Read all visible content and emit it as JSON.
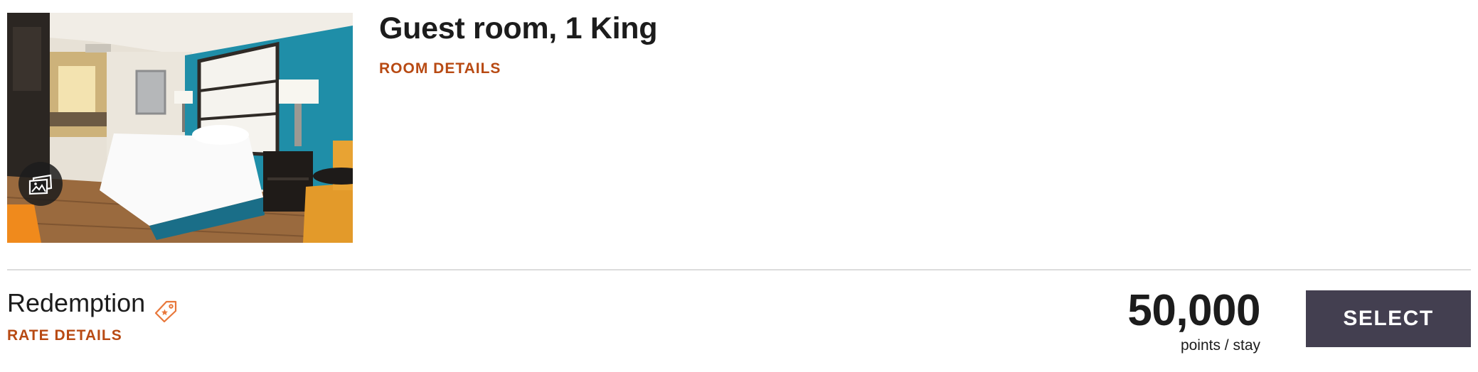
{
  "room": {
    "title": "Guest room, 1 King",
    "details_link": "ROOM DETAILS",
    "photo_icon": "photo-gallery-icon"
  },
  "rate": {
    "name": "Redemption",
    "tag_icon": "tag-icon",
    "details_link": "RATE DETAILS",
    "price": "50,000",
    "price_unit": "points / stay",
    "select_label": "SELECT"
  },
  "colors": {
    "accent_link": "#b84a13",
    "button_bg": "#433f50",
    "button_text": "#ffffff",
    "text": "#1c1c1c",
    "divider": "#dcdcdc",
    "tag_icon": "#e8773a"
  }
}
